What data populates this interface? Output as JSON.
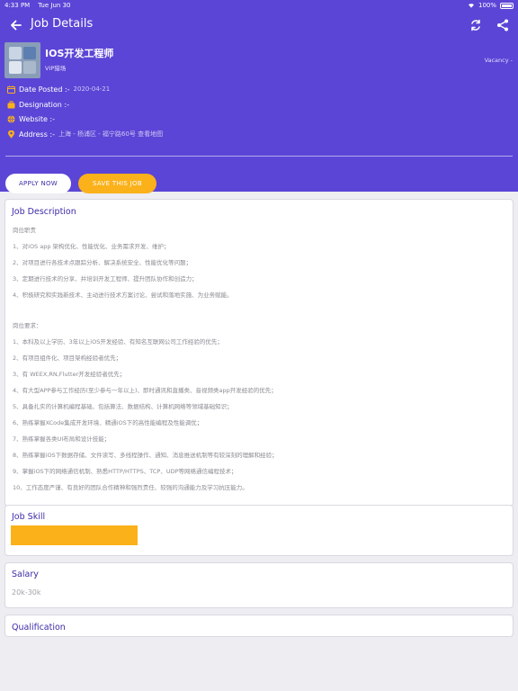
{
  "status": {
    "time": "4:33 PM",
    "date": "Tue Jun 30",
    "battery": "100%"
  },
  "appbar": {
    "title": "Job Details"
  },
  "job": {
    "title": "IOS开发工程师",
    "company": "VIP猎场",
    "vacancy": "Vacancy -"
  },
  "info": {
    "date_posted_label": "Date Posted :-",
    "date_posted_value": "2020-04-21",
    "designation_label": "Designation :-",
    "website_label": "Website :-",
    "address_label": "Address :-",
    "address_value": "上海 - 杨浦区 - 福宁路60号 查看地图"
  },
  "buttons": {
    "apply": "APPLY NOW",
    "save": "SAVE THIS JOB"
  },
  "description": {
    "title": "Job Description",
    "lines": [
      "岗位职责",
      "1、对iOS app 架构优化、性能优化、业务需求开发、维护；",
      "2、对项目进行各技术点跟踪分析、解决系统安全、性能优化等问题；",
      "3、定期进行技术的分享、并培训开发工程师、提升团队协作和创造力；",
      "4、积极研究和实践新技术、主动进行技术方案讨论、尝试和落地实施、为业务赋能。",
      "岗位要求：",
      "1、本科及以上学历、3年以上iOS开发经验、有知名互联网公司工作经验的优先；",
      "2、有项目组件化、项目架构经验者优先；",
      "3、有 WEEX,RN,Flutter开发经验者优先；",
      "4、有大型APP参与工作经历(至少参与一年以上)、即时通讯和直播类、音视频类app开发经验的优先；",
      "5、具备扎实的计算机编程基础、包括算法、数据结构、计算机网络等领域基础知识；",
      "6、熟练掌握XCode集成开发环境、精通iOS下的高性能编程及性能调优；",
      "7、熟练掌握各类UI布局和设计技能；",
      "8、熟练掌握iOS下数据存储、文件读写、多线程操作、通知、消息推送机制等有较深刻的理解和经验；",
      "9、掌握iOS下的网络通信机制、熟悉HTTP/HTTPS、TCP、UDP等网络通信编程技术；",
      "10、工作态度严谨、有良好的团队合作精神和强烈责任、较强的沟通能力及学习抗压能力。"
    ]
  },
  "skill": {
    "title": "Job Skill"
  },
  "salary": {
    "title": "Salary",
    "value": "20k-30k"
  },
  "qualification": {
    "title": "Qualification"
  },
  "colors": {
    "primary": "#5b45d6",
    "accent": "#fbb11a",
    "title": "#3a2ca8"
  }
}
